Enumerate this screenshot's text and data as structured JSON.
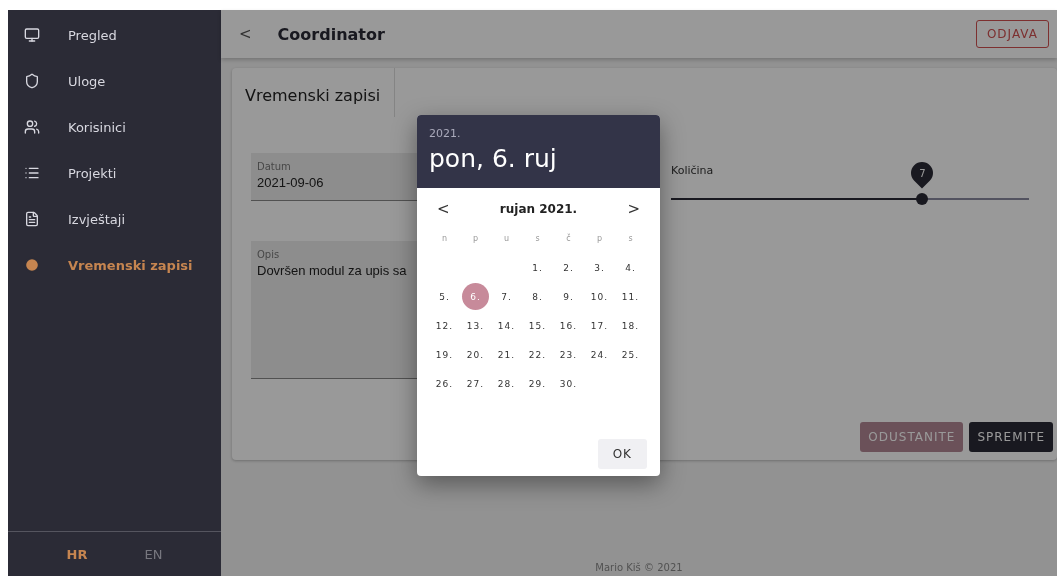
{
  "sidebar": {
    "items": [
      {
        "label": "Pregled",
        "selected": false
      },
      {
        "label": "Uloge",
        "selected": false
      },
      {
        "label": "Korisinici",
        "selected": false
      },
      {
        "label": "Projekti",
        "selected": false
      },
      {
        "label": "Izvještaji",
        "selected": false
      },
      {
        "label": "Vremenski zapisi",
        "selected": true
      }
    ],
    "languages": [
      {
        "label": "HR",
        "selected": true
      },
      {
        "label": "EN",
        "selected": false
      }
    ]
  },
  "header": {
    "back": "<",
    "title": "Coordinator",
    "logout": "ODJAVA"
  },
  "card": {
    "tab": "Vremenski zapisi",
    "datum": {
      "label": "Datum",
      "value": "2021-09-06"
    },
    "opis": {
      "label": "Opis",
      "value": "Dovršen modul za upis sa"
    },
    "kolicina": {
      "label": "Količina",
      "value": "7",
      "level": 0.7
    },
    "buttons": [
      {
        "label": "ODUSTANITE",
        "kind": "cancel"
      },
      {
        "label": "SPREMITE",
        "kind": "save"
      }
    ]
  },
  "footer": "Mario Kiš © 2021",
  "dialog": {
    "year": "2021.",
    "date": "pon, 6. ruj",
    "month": "rujan 2021.",
    "prev": "<",
    "next": ">",
    "weekdays": [
      "n",
      "p",
      "u",
      "s",
      "č",
      "p",
      "s"
    ],
    "weeks": [
      [
        {
          "day": "1.",
          "selected": false
        },
        {
          "day": "2.",
          "selected": false
        },
        {
          "day": "3.",
          "selected": false
        },
        {
          "day": "4.",
          "selected": false
        }
      ],
      [
        {
          "day": "5.",
          "selected": false
        },
        {
          "day": "6.",
          "selected": true
        },
        {
          "day": "7.",
          "selected": false
        },
        {
          "day": "8.",
          "selected": false
        },
        {
          "day": "9.",
          "selected": false
        },
        {
          "day": "10.",
          "selected": false
        },
        {
          "day": "11.",
          "selected": false
        }
      ],
      [
        {
          "day": "12.",
          "selected": false
        },
        {
          "day": "13.",
          "selected": false
        },
        {
          "day": "14.",
          "selected": false
        },
        {
          "day": "15.",
          "selected": false
        },
        {
          "day": "16.",
          "selected": false
        },
        {
          "day": "17.",
          "selected": false
        },
        {
          "day": "18.",
          "selected": false
        }
      ],
      [
        {
          "day": "19.",
          "selected": false
        },
        {
          "day": "20.",
          "selected": false
        },
        {
          "day": "21.",
          "selected": false
        },
        {
          "day": "22.",
          "selected": false
        },
        {
          "day": "23.",
          "selected": false
        },
        {
          "day": "24.",
          "selected": false
        },
        {
          "day": "25.",
          "selected": false
        }
      ],
      [
        {
          "day": "26.",
          "selected": false
        },
        {
          "day": "27.",
          "selected": false
        },
        {
          "day": "28.",
          "selected": false
        },
        {
          "day": "29.",
          "selected": false
        },
        {
          "day": "30.",
          "selected": false
        }
      ]
    ],
    "ok": "OK"
  }
}
